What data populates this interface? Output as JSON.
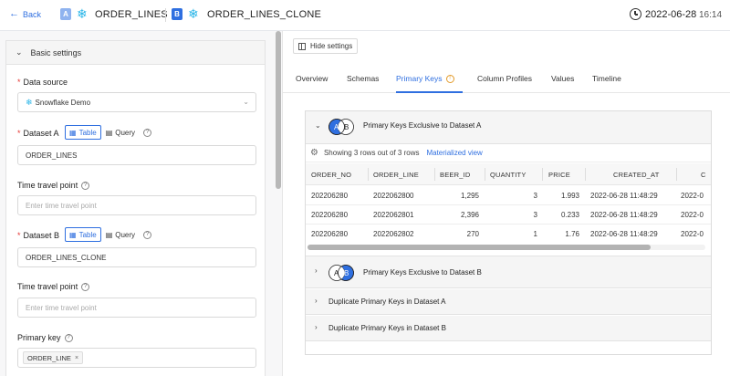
{
  "header": {
    "back_label": "Back",
    "dataset_a": {
      "badge": "A",
      "name": "ORDER_LINES",
      "icon": "snowflake-icon"
    },
    "dataset_b": {
      "badge": "B",
      "name": "ORDER_LINES_CLONE",
      "icon": "snowflake-icon"
    },
    "timestamp_date": "2022-06-28",
    "timestamp_time": "16:14"
  },
  "settings": {
    "section_title": "Basic settings",
    "data_source": {
      "label": "Data source",
      "value": "Snowflake Demo"
    },
    "dataset_a": {
      "label": "Dataset A",
      "mode_table": "Table",
      "mode_query": "Query",
      "value": "ORDER_LINES"
    },
    "time_travel_a": {
      "label": "Time travel point",
      "placeholder": "Enter time travel point"
    },
    "dataset_b": {
      "label": "Dataset B",
      "mode_table": "Table",
      "mode_query": "Query",
      "value": "ORDER_LINES_CLONE"
    },
    "time_travel_b": {
      "label": "Time travel point",
      "placeholder": "Enter time travel point"
    },
    "primary_key": {
      "label": "Primary key",
      "tags": [
        "ORDER_LINE"
      ]
    }
  },
  "toolbar": {
    "hide_settings_label": "Hide settings"
  },
  "tabs": [
    "Overview",
    "Schemas",
    "Primary Keys",
    "Column Profiles",
    "Values",
    "Timeline"
  ],
  "active_tab": "Primary Keys",
  "sections": {
    "exclusive_a": "Primary Keys Exclusive to Dataset A",
    "exclusive_b": "Primary Keys Exclusive to Dataset B",
    "duplicate_a": "Duplicate Primary Keys in Dataset A",
    "duplicate_b": "Duplicate Primary Keys in Dataset B"
  },
  "table": {
    "summary": "Showing 3 rows out of 3 rows",
    "materialized_link": "Materialized view",
    "columns": [
      "ORDER_NO",
      "ORDER_LINE",
      "BEER_ID",
      "QUANTITY",
      "PRICE",
      "CREATED_AT",
      "C"
    ],
    "rows": [
      [
        "202206280",
        "2022062800",
        "1,295",
        "3",
        "1.993",
        "2022-06-28 11:48:29",
        "2022-0"
      ],
      [
        "202206280",
        "2022062801",
        "2,396",
        "3",
        "0.233",
        "2022-06-28 11:48:29",
        "2022-0"
      ],
      [
        "202206280",
        "2022062802",
        "270",
        "1",
        "1.76",
        "2022-06-28 11:48:29",
        "2022-0"
      ]
    ]
  },
  "colors": {
    "accent": "#2f6fe0",
    "snowflake": "#29b5e8",
    "required": "#e53935",
    "warning": "#e39b2a"
  }
}
